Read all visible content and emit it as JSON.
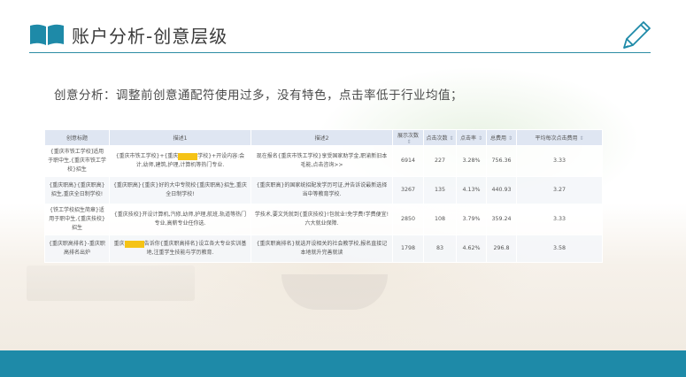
{
  "header": {
    "title": "账户分析-创意层级"
  },
  "analysis_text": "创意分析：调整前创意通配符使用过多，没有特色，点击率低于行业均值；",
  "colors": {
    "accent": "#1e8aa8",
    "redaction": "#f5c316"
  },
  "table": {
    "headers": [
      "创意标题",
      "描述1",
      "描述2",
      "展示次数",
      "点击次数",
      "点击率",
      "总费用",
      "平均每次点击费用"
    ],
    "rows": [
      {
        "title": "{重庆市铁工学校]适用于职中生,{重庆市铁工学校}招生",
        "desc1_a": "{重庆市铁工学校}+{重庆",
        "desc1_b": "学校}+开设内容:会计,幼师,建筑,护理,计算机等热门专业.",
        "desc2": "现在报名{重庆市铁工学校}享受国家助学金,职渝新旧本毛能,点击咨询>>",
        "impressions": "6914",
        "clicks": "227",
        "ctr": "3.28%",
        "cost": "756.36",
        "cpc": "3.33"
      },
      {
        "title": "{重庆职高}{重庆职高}招生,重庆全日制学校!",
        "desc1_a": "{重庆职高}{重庆}好的大中专院校{重庆职高}招生,重庆全日制学校!",
        "desc1_b": "",
        "desc2": "{重庆职高}的国家统招配发学历可证,并告诉说最新选择当中等教育学校.",
        "impressions": "3267",
        "clicks": "135",
        "ctr": "4.13%",
        "cost": "440.93",
        "cpc": "3.27"
      },
      {
        "title": "{铁工学校招生简章}适用于职中生,{重庆技校}招生",
        "desc1_a": "{重庆技校}开设计算机,汽修,幼师,护理,航班,轨道等热门专业,高薪专业任你选.",
        "desc1_b": "",
        "desc2": "学技术,要文凭就到{重庆技校}!包就业!免学费!学费便宜!六大就业保障.",
        "impressions": "2850",
        "clicks": "108",
        "ctr": "3.79%",
        "cost": "359.24",
        "cpc": "3.33"
      },
      {
        "title": "{重庆职高排名}-重庆职高排名出炉",
        "desc1_a": "重庆",
        "desc1_b": "告诉你{重庆职高排名}设立各大专业实训基地,注重学生技能与学历教育.",
        "desc2": "{重庆职高排名}就选开设相关的社会教学校,报名直接记本地就升完善就读",
        "impressions": "1798",
        "clicks": "83",
        "ctr": "4.62%",
        "cost": "296.8",
        "cpc": "3.58"
      }
    ]
  }
}
